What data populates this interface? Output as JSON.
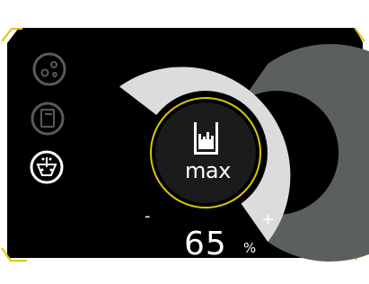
{
  "colors": {
    "background": "#000000",
    "frame_accent": "#d8c800",
    "gauge_fill": "#dcdcdc",
    "gauge_track": "#5b5f60",
    "sidebar_inactive": "#5a5a5a",
    "sidebar_active": "#ffffff",
    "text": "#ffffff"
  },
  "sidebar": {
    "items": [
      {
        "icon": "rinse-aid-drops-icon",
        "active": false
      },
      {
        "icon": "detergent-container-icon",
        "active": false
      },
      {
        "icon": "salt-dosing-icon",
        "active": true
      }
    ]
  },
  "gauge": {
    "level_percent": 65,
    "minus_label": "-",
    "plus_label": "+",
    "center_icon": "container-level-icon",
    "center_label": "max",
    "value": "65",
    "unit": "%"
  }
}
